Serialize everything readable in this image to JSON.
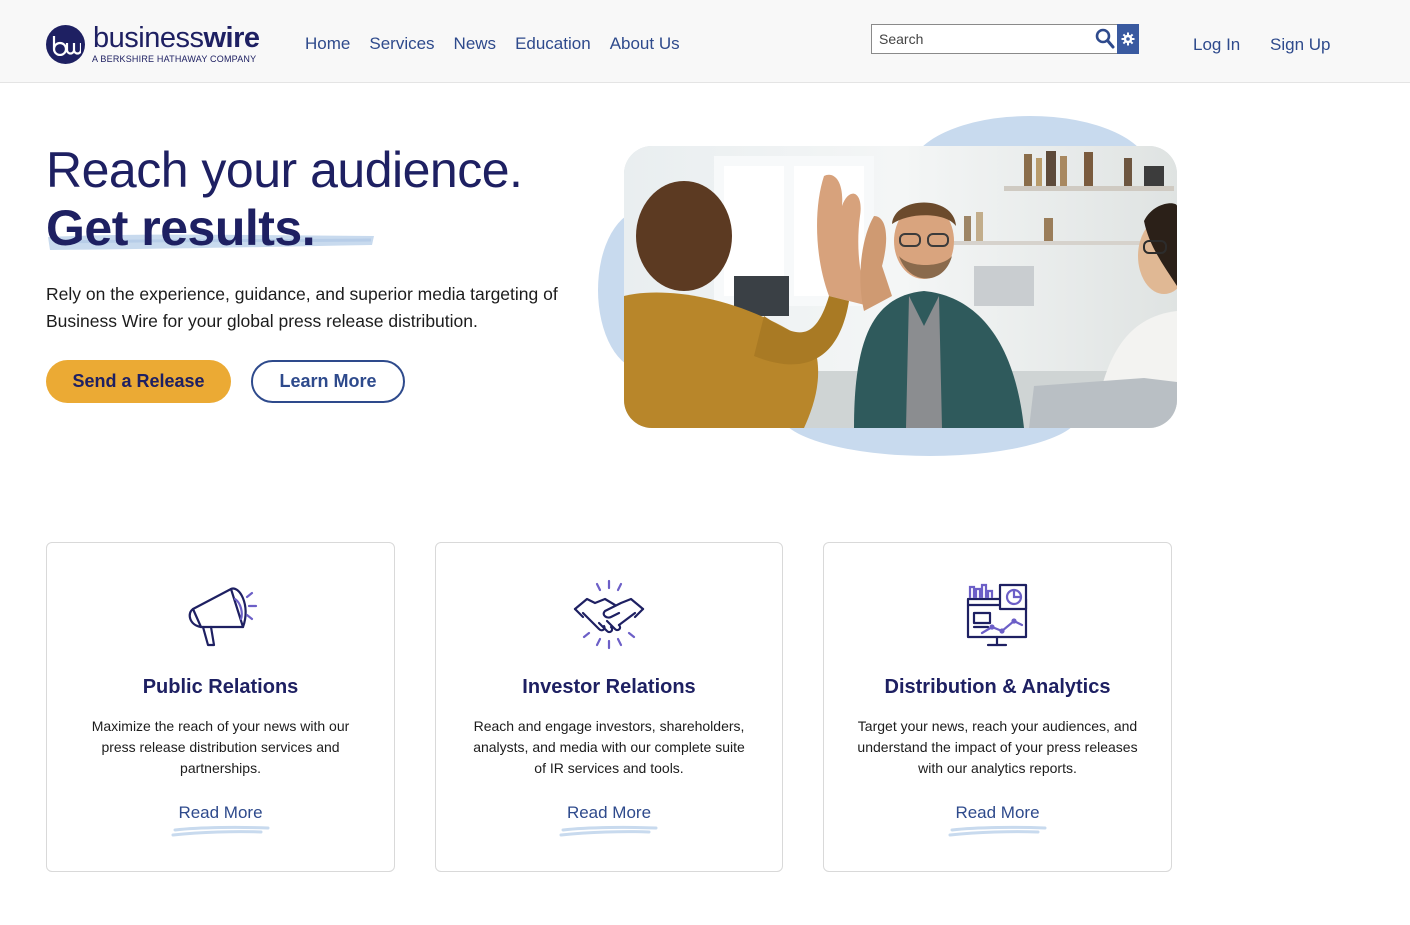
{
  "header": {
    "logo": {
      "mark": "bw",
      "word_light": "business",
      "word_bold": "wire",
      "tagline": "A BERKSHIRE HATHAWAY COMPANY"
    },
    "nav": [
      {
        "label": "Home"
      },
      {
        "label": "Services"
      },
      {
        "label": "News"
      },
      {
        "label": "Education"
      },
      {
        "label": "About Us"
      }
    ],
    "search": {
      "placeholder": "Search",
      "value": ""
    },
    "icons": {
      "search": "search-icon",
      "settings": "gear-icon"
    },
    "login_label": "Log In",
    "signup_label": "Sign Up"
  },
  "hero": {
    "title_line1": "Reach your audience.",
    "title_line2": "Get results.",
    "description": "Rely on the experience, guidance, and superior media targeting of Business Wire for your global press release distribution.",
    "primary_cta": "Send a Release",
    "secondary_cta": "Learn More"
  },
  "cards": [
    {
      "icon": "megaphone-icon",
      "title": "Public Relations",
      "text": "Maximize the reach of your news with our press release distribution services and partnerships.",
      "link": "Read More"
    },
    {
      "icon": "handshake-icon",
      "title": "Investor Relations",
      "text": "Reach and engage investors, shareholders, analysts, and media with our complete suite of IR services and tools.",
      "link": "Read More"
    },
    {
      "icon": "analytics-dashboard-icon",
      "title": "Distribution & Analytics",
      "text": "Target your news, reach your audiences, and understand the impact of your press releases with our analytics reports.",
      "link": "Read More"
    }
  ],
  "colors": {
    "navy": "#1e2062",
    "link_blue": "#2e4a8c",
    "cta_gold": "#ebaa34",
    "blob_blue": "#c8daee",
    "icon_purple": "#6c5fc7"
  }
}
